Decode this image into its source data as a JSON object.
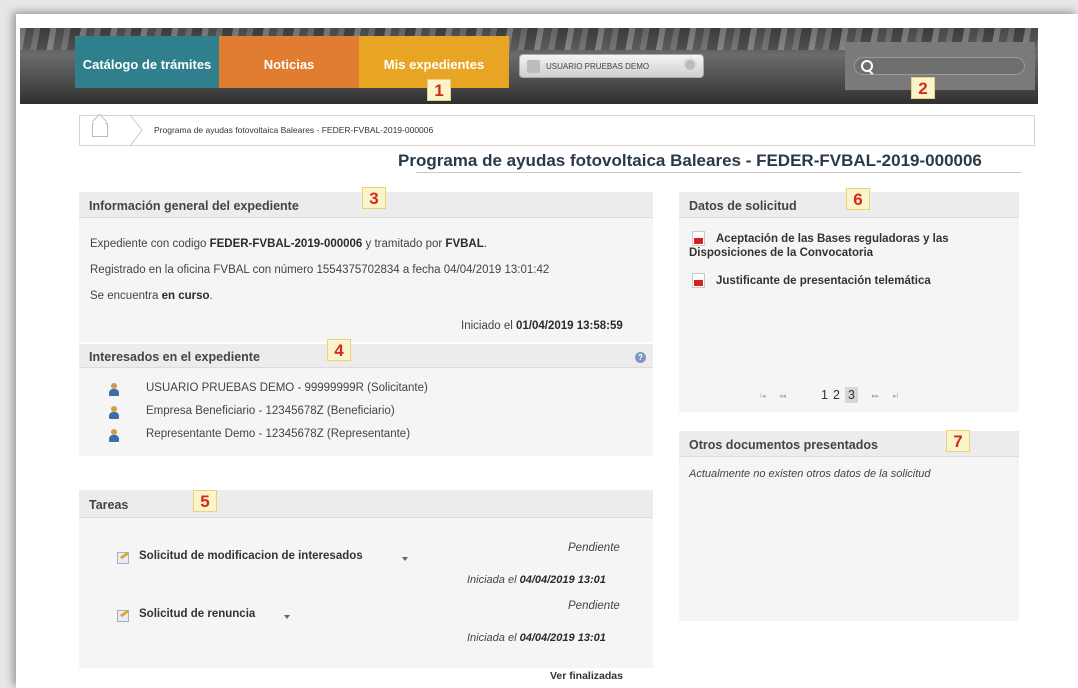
{
  "nav": {
    "tab_catalogo": "Catálogo de trámites",
    "tab_noticias": "Noticias",
    "tab_mis_expedientes": "Mis expedientes",
    "user_label": "USUARIO PRUEBAS DEMO",
    "search_placeholder": ""
  },
  "callouts": [
    "1",
    "2",
    "3",
    "4",
    "5",
    "6",
    "7"
  ],
  "breadcrumb": {
    "current": "Programa de ayudas fotovoltaica Baleares - FEDER-FVBAL-2019-000006"
  },
  "page_title": "Programa de ayudas fotovoltaica Baleares - FEDER-FVBAL-2019-000006",
  "info": {
    "heading": "Información general del expediente",
    "line1_pre": "Expediente con codigo ",
    "line1_code": "FEDER-FVBAL-2019-000006",
    "line1_mid": " y tramitado por ",
    "line1_org": "FVBAL",
    "line1_end": ".",
    "line2": "Registrado en la oficina FVBAL con número 1554375702834 a fecha 04/04/2019 13:01:42",
    "line3_pre": "Se encuentra ",
    "line3_state": "en curso",
    "line3_end": ".",
    "started_pre": "Iniciado el ",
    "started_date": "01/04/2019 13:58:59"
  },
  "interesados": {
    "heading": "Interesados en el expediente",
    "items": [
      "USUARIO PRUEBAS DEMO - 99999999R (Solicitante)",
      "Empresa Beneficiario - 12345678Z (Beneficiario)",
      "Representante Demo - 12345678Z (Representante)"
    ]
  },
  "tareas": {
    "heading": "Tareas",
    "items": [
      {
        "name": "Solicitud de modificacion de interesados",
        "status": "Pendiente",
        "started_pre": "Iniciada el ",
        "started_date": "04/04/2019 13:01"
      },
      {
        "name": "Solicitud de renuncia",
        "status": "Pendiente",
        "started_pre": "Iniciada el ",
        "started_date": "04/04/2019 13:01"
      }
    ],
    "ver_finalizadas": "Ver finalizadas"
  },
  "datos": {
    "heading": "Datos de solicitud",
    "docs": [
      "Aceptación de las Bases reguladoras y las",
      "Disposiciones de la Convocatoria",
      "Justificante de presentación telemática"
    ],
    "pager": {
      "first": "I◂",
      "prev": "◂◂",
      "pages": [
        "1",
        "2",
        "3"
      ],
      "current": "3",
      "next": "▸▸",
      "last": "▸I"
    }
  },
  "otros": {
    "heading": "Otros documentos presentados",
    "empty": "Actualmente no existen otros datos de la solicitud"
  },
  "colors": {
    "tab_catalogo": "#2f7f8c",
    "tab_noticias": "#e17d31",
    "tab_mis_expedientes": "#e8a523",
    "callout_text": "#d42a1e"
  }
}
